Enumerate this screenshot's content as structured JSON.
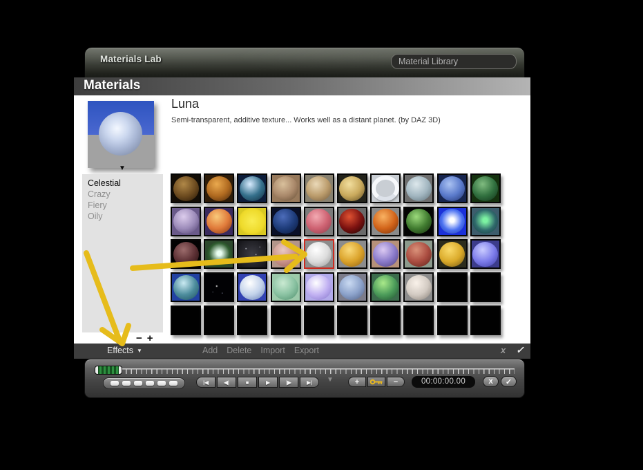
{
  "titlebar": {
    "title": "Materials Lab",
    "library_label": "Material Library"
  },
  "header": {
    "label": "Materials"
  },
  "material": {
    "name": "Luna",
    "description": "Semi-transparent, additive texture... Works well as a distant planet. (by DAZ 3D)"
  },
  "icons": {
    "dropdown": "▼"
  },
  "categories": {
    "items": [
      {
        "label": "Celestial",
        "selected": true
      },
      {
        "label": "Crazy",
        "selected": false
      },
      {
        "label": "Fiery",
        "selected": false
      },
      {
        "label": "Oily",
        "selected": false
      }
    ],
    "shrink_label": "−",
    "grow_label": "+"
  },
  "grid": {
    "columns": 10,
    "rows": 5,
    "cells": [
      {
        "bg": "#130d06",
        "hl": "#b08848",
        "mid": "#6e4c20",
        "dk": "#241505"
      },
      {
        "bg": "#2e1c09",
        "hl": "#eaa94e",
        "mid": "#b06a20",
        "dk": "#45250a"
      },
      {
        "bg": "#0d1d3a",
        "hl": "#d8ecff",
        "mid": "#35708c",
        "dk": "#0f2a3a"
      },
      {
        "bg": "#97795b",
        "hl": "#d9c09c",
        "mid": "#a9886a",
        "dk": "#5f4931"
      },
      {
        "bg": "#87806f",
        "hl": "#ead9b8",
        "mid": "#bb9c6c",
        "dk": "#6e573a"
      },
      {
        "bg": "#23231b",
        "hl": "#f2de9e",
        "mid": "#c9a95c",
        "dk": "#5d4a20"
      },
      {
        "bg": "#c9ced4",
        "hl": "#ffffff",
        "mid": "#e8e8ec",
        "dk": "#9aa0aa",
        "type": "ring"
      },
      {
        "bg": "#6e6e6e",
        "hl": "#dde8ec",
        "mid": "#a2b6c0",
        "dk": "#5a6c74"
      },
      {
        "bg": "#17254e",
        "hl": "#aac2f2",
        "mid": "#5a7acb",
        "dk": "#20316b"
      },
      {
        "bg": "#15320f",
        "hl": "#80bc80",
        "mid": "#31703f",
        "dk": "#102f18"
      },
      {
        "bg": "#6a5a8a",
        "hl": "#dcccec",
        "mid": "#9d8cba",
        "dk": "#4c3c6c"
      },
      {
        "bg": "#3a2a5e",
        "hl": "#f9c97a",
        "mid": "#e07a3a",
        "dk": "#7c3210"
      },
      {
        "bg": "#d9c922",
        "hl": "#f9ed52",
        "mid": "#eeda2a",
        "dk": "#c2aa1a",
        "type": "flat"
      },
      {
        "bg": "#0a1028",
        "hl": "#4c6cba",
        "mid": "#1e3c7a",
        "dk": "#0a1838"
      },
      {
        "bg": "#7b7b7b",
        "hl": "#f2aab2",
        "mid": "#ce6272",
        "dk": "#8c3c4a"
      },
      {
        "bg": "#6a6a6a",
        "hl": "#e05232",
        "mid": "#7c1210",
        "dk": "#180404"
      },
      {
        "bg": "#8a8a8a",
        "hl": "#f9b262",
        "mid": "#d2641a",
        "dk": "#722e0a"
      },
      {
        "bg": "#040404",
        "hl": "#9cda7c",
        "mid": "#417c30",
        "dk": "#142c0c"
      },
      {
        "bg": "#1b31d9",
        "hl": "#ffffff",
        "mid": "#4c72f2",
        "dk": "#1a32a2",
        "type": "glow"
      },
      {
        "bg": "#3c5c6c",
        "hl": "#7cf2a2",
        "mid": "#30696c",
        "dk": "#143c3e",
        "type": "glow"
      },
      {
        "bg": "#020202",
        "hl": "#9c6c6c",
        "mid": "#5c3034",
        "dk": "#1c0a0a"
      },
      {
        "bg": "#2c482c",
        "hl": "#eafff2",
        "mid": "#305c30",
        "dk": "#102c10",
        "type": "glow"
      },
      {
        "bg": "#0c0c10",
        "hl": "#caccd4",
        "mid": "#3c3c44",
        "dk": "#121216",
        "type": "speckle"
      },
      {
        "bg": "#b3958a",
        "hl": "#eacac2",
        "mid": "#ca928a",
        "dk": "#8c5c52"
      },
      {
        "bg": "#8c8c8c",
        "hl": "#ffffff",
        "mid": "#dcdcdc",
        "dk": "#949494",
        "selected": true
      },
      {
        "bg": "#8c8c8c",
        "hl": "#fada7a",
        "mid": "#daa22a",
        "dk": "#8c5e12"
      },
      {
        "bg": "#b6917a",
        "hl": "#dccaf2",
        "mid": "#8a7aca",
        "dk": "#4c3e7a"
      },
      {
        "bg": "#8c9a8c",
        "hl": "#da927a",
        "mid": "#aa4c40",
        "dk": "#5c221a"
      },
      {
        "bg": "#2c2c1c",
        "hl": "#fada6a",
        "mid": "#daaa2a",
        "dk": "#6c5212"
      },
      {
        "bg": "#3c3c8c",
        "hl": "#caccff",
        "mid": "#7c7cea",
        "dk": "#3a3aa2"
      },
      {
        "bg": "#2242a2",
        "hl": "#caeaf2",
        "mid": "#4c8c9c",
        "dk": "#1c4c5c"
      },
      {
        "bg": "#010104",
        "hl": "#ffffff",
        "mid": "#0c0c1a",
        "dk": "#000000",
        "type": "stars"
      },
      {
        "bg": "#3242b2",
        "hl": "#ffffff",
        "mid": "#c2d2ea",
        "dk": "#6279b2"
      },
      {
        "bg": "#9cc9aa",
        "hl": "#caead2",
        "mid": "#8ac2a2",
        "dk": "#4c8c6a"
      },
      {
        "bg": "#b2aaea",
        "hl": "#ffffff",
        "mid": "#c2b2f2",
        "dk": "#8272ca"
      },
      {
        "bg": "#7c7c8a",
        "hl": "#cadaf2",
        "mid": "#8ca2ca",
        "dk": "#4c5c82"
      },
      {
        "bg": "#3c6c4c",
        "hl": "#aaea8a",
        "mid": "#4c9c5a",
        "dk": "#1c4c2c"
      },
      {
        "bg": "#8c8c8c",
        "hl": "#faf2ea",
        "mid": "#d2cac2",
        "dk": "#827a72"
      },
      {
        "type": "empty"
      },
      {
        "type": "empty"
      },
      {
        "type": "empty"
      },
      {
        "type": "empty"
      },
      {
        "type": "empty"
      },
      {
        "type": "empty"
      },
      {
        "type": "empty"
      },
      {
        "type": "empty"
      },
      {
        "type": "empty"
      },
      {
        "type": "empty"
      },
      {
        "type": "empty"
      },
      {
        "type": "empty"
      }
    ]
  },
  "footer": {
    "effects_label": "Effects",
    "actions": [
      "Add",
      "Delete",
      "Import",
      "Export"
    ],
    "cancel_label": "x",
    "confirm_label": "✓"
  },
  "timeline": {
    "time": "00:00:00.00",
    "transport": [
      "|◀",
      "◀|",
      "■",
      "▶",
      "|▶",
      "▶|"
    ],
    "add_key_label": "+",
    "remove_key_label": "−",
    "cancel_label": "X",
    "confirm_label": "✓",
    "nudge_count": 6
  },
  "annotations": {
    "color": "#e6bc1b"
  }
}
